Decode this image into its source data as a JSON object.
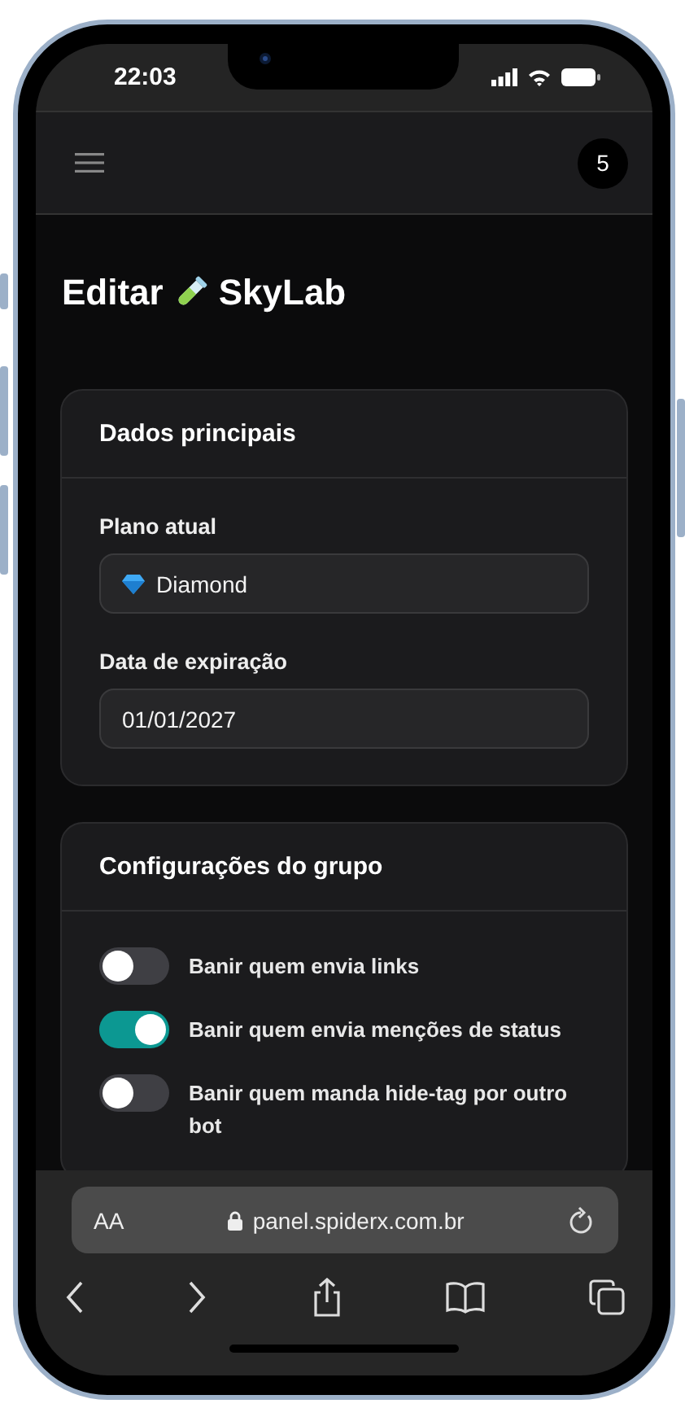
{
  "status_bar": {
    "time": "22:03"
  },
  "header": {
    "badge": "5"
  },
  "page_title": {
    "prefix": "Editar",
    "name": "SkyLab"
  },
  "main_card": {
    "title": "Dados principais",
    "fields": [
      {
        "label": "Plano atual",
        "value": "Diamond",
        "kind": "plan"
      },
      {
        "label": "Data de expiração",
        "value": "01/01/2027",
        "kind": "date"
      }
    ]
  },
  "group_card": {
    "title": "Configurações do grupo",
    "toggles": [
      {
        "label": "Banir quem envia links",
        "on": false
      },
      {
        "label": "Banir quem envia menções de status",
        "on": true
      },
      {
        "label": "Banir quem manda hide-tag por outro bot",
        "on": false
      }
    ]
  },
  "browser": {
    "text_size": "AA",
    "url": "panel.spiderx.com.br"
  }
}
